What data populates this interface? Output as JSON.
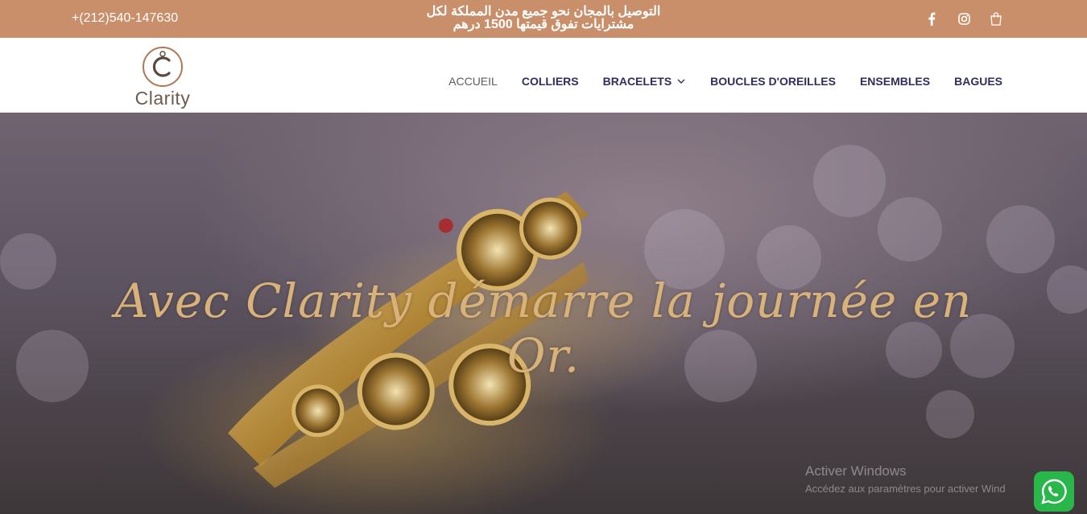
{
  "topbar": {
    "phone": "+(212)540-147630",
    "promo_line1": "التوصيل بالمجان نحو جميع مدن المملكة لكل",
    "promo_line2": "مشترايات تفوق قيمتها 1500 درهم",
    "icons": [
      "facebook-icon",
      "instagram-icon",
      "shopping-bag-icon"
    ]
  },
  "header": {
    "logo_text": "Clarity",
    "menu": [
      {
        "label": "ACCUEIL",
        "active": true
      },
      {
        "label": "COLLIERS"
      },
      {
        "label": "BRACELETS",
        "dropdown": true
      },
      {
        "label": "BOUCLES D'OREILLES"
      },
      {
        "label": "ENSEMBLES"
      },
      {
        "label": "BAGUES"
      }
    ]
  },
  "hero": {
    "title": "Avec Clarity démarre la journée en Or."
  },
  "watermark": {
    "title": "Activer Windows",
    "subtitle": "Accédez aux paramètres pour activer Wind"
  },
  "colors": {
    "topbar": "#c98f6b",
    "menu_text": "#2e2f5d",
    "hero_title": "#d9b27a",
    "whatsapp": "#29b64a"
  }
}
